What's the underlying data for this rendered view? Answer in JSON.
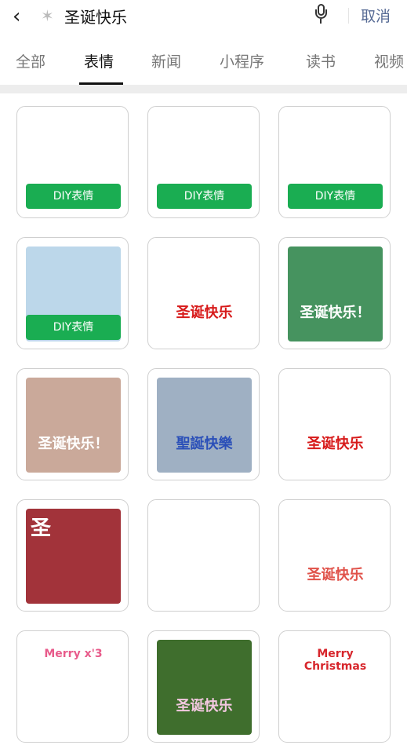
{
  "search": {
    "query": "圣诞快乐",
    "cancel_label": "取消"
  },
  "tabs": [
    {
      "label": "全部"
    },
    {
      "label": "表情"
    },
    {
      "label": "新闻"
    },
    {
      "label": "小程序"
    },
    {
      "label": "读书"
    },
    {
      "label": "视频"
    }
  ],
  "active_tab": "表情",
  "diy_label": "DIY表情",
  "stickers": [
    {
      "bg": "#ffffff",
      "diy": true,
      "lettering": "",
      "color": "#e33"
    },
    {
      "bg": "#ffffff",
      "diy": true,
      "lettering": "",
      "color": "#e33"
    },
    {
      "bg": "#ffffff",
      "diy": true,
      "lettering": "",
      "color": "#e33"
    },
    {
      "bg": "#bcd7ea",
      "diy": true,
      "lettering": "",
      "color": "#e33"
    },
    {
      "bg": "#ffffff",
      "diy": false,
      "lettering": "圣诞快乐",
      "color": "#d71a1a"
    },
    {
      "bg": "#46935f",
      "diy": false,
      "lettering": "圣诞快乐！",
      "color": "#ffffff"
    },
    {
      "bg": "#caa99a",
      "diy": false,
      "lettering": "圣诞快乐！",
      "color": "#ffffff"
    },
    {
      "bg": "#9fb0c3",
      "diy": false,
      "lettering": "聖誕快樂",
      "color": "#2a4fb8"
    },
    {
      "bg": "#ffffff",
      "diy": false,
      "lettering": "圣诞快乐",
      "color": "#d71a1a"
    },
    {
      "bg": "#a2333a",
      "diy": false,
      "lettering": "圣",
      "color": "#ffffff"
    },
    {
      "bg": "#ffffff",
      "diy": false,
      "lettering": "",
      "color": "#333"
    },
    {
      "bg": "#ffffff",
      "diy": false,
      "lettering": "圣诞快乐",
      "color": "#e0524a"
    },
    {
      "bg": "#ffffff",
      "diy": false,
      "lettering": "Merry x'3",
      "color": "#e85b8b"
    },
    {
      "bg": "#3f6e2d",
      "diy": false,
      "lettering": "圣诞快乐",
      "color": "#f2c8e0"
    },
    {
      "bg": "#ffffff",
      "diy": false,
      "lettering": "Merry Christmas",
      "color": "#d7262c"
    }
  ]
}
